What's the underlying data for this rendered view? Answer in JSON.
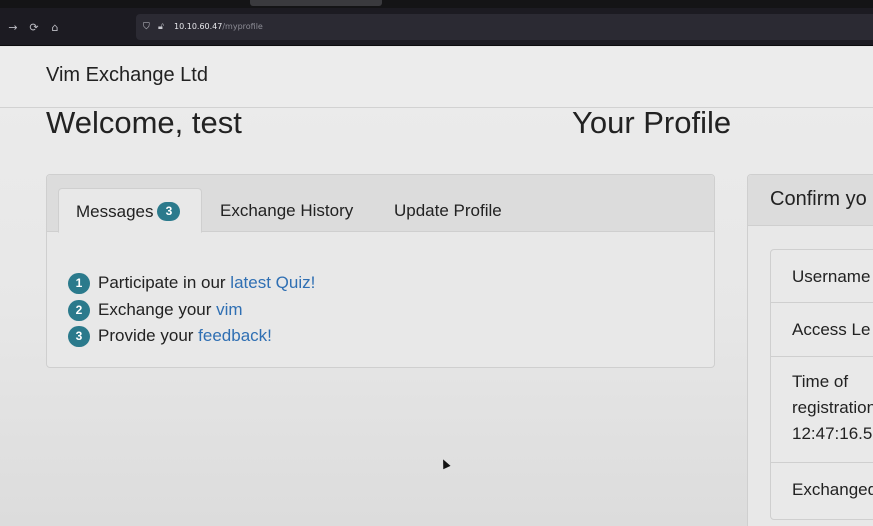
{
  "browser": {
    "url_host": "10.10.60.47",
    "url_path": "/myprofile",
    "icons": [
      "forward-icon",
      "reload-icon",
      "home-icon",
      "shield-icon",
      "lock-icon"
    ]
  },
  "navbar": {
    "brand": "Vim Exchange Ltd"
  },
  "header": {
    "welcome": "Welcome, test",
    "profile_title": "Your Profile"
  },
  "tabs": {
    "messages": {
      "label": "Messages",
      "badge": "3"
    },
    "exchange_history": {
      "label": "Exchange History"
    },
    "update_profile": {
      "label": "Update Profile"
    }
  },
  "messages": [
    {
      "num": "1",
      "text": "Participate in our ",
      "link": "latest Quiz!"
    },
    {
      "num": "2",
      "text": "Exchange your ",
      "link": "vim"
    },
    {
      "num": "3",
      "text": "Provide your ",
      "link": "feedback!"
    }
  ],
  "confirm": {
    "title": "Confirm yo",
    "items": {
      "username": "Username",
      "access_level": "Access Le",
      "time_line1": "Time of",
      "time_line2": "registration",
      "time_line3": "12:47:16.5",
      "exchanged": "Exchanged"
    }
  },
  "colors": {
    "accent_badge": "#2b7a8c",
    "link": "#2f6fb3",
    "chrome_dark": "#1c1b22"
  }
}
